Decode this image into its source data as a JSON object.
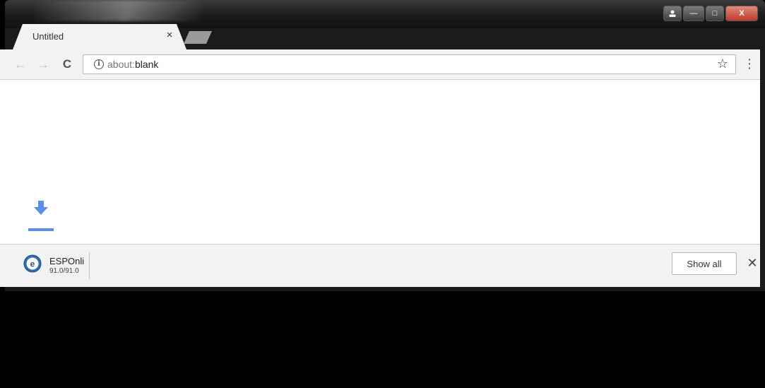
{
  "tab": {
    "title": "Untitled",
    "close_glyph": "×"
  },
  "toolbar": {
    "back_glyph": "←",
    "forward_glyph": "→",
    "reload_glyph": "C",
    "info_glyph": "i",
    "url_scheme": "about:",
    "url_path": "blank",
    "star_glyph": "☆",
    "menu_glyph": "⋮"
  },
  "caption": {
    "minimize": "—",
    "maximize": "□",
    "close": "X"
  },
  "download": {
    "file_name": "ESPOnli",
    "progress": "91.0/91.0",
    "show_all_label": "Show all",
    "close_glyph": "✕"
  },
  "colors": {
    "accent": "#5b8dee",
    "shelf": "#f2f2f2",
    "frame": "#1b1b1b"
  }
}
